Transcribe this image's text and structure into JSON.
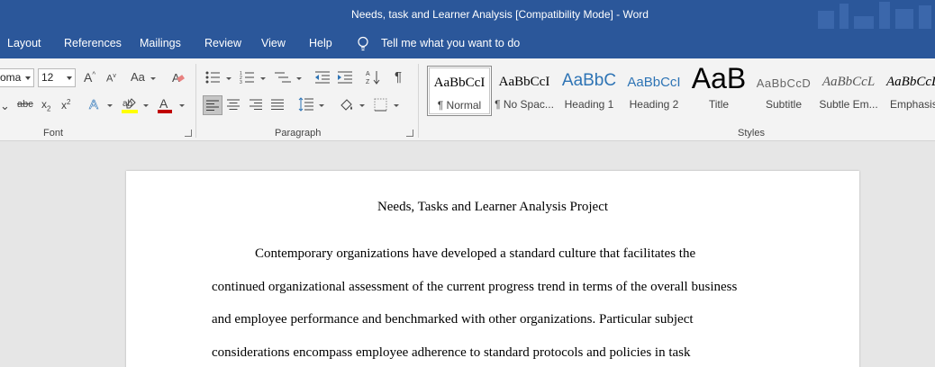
{
  "window": {
    "title": "Needs, task and Learner Analysis [Compatibility Mode]  -  Word"
  },
  "menu": {
    "tabs": [
      "Layout",
      "References",
      "Mailings",
      "Review",
      "View",
      "Help"
    ],
    "tell_me": "Tell me what you want to do"
  },
  "ribbon": {
    "font": {
      "group_label": "Font",
      "font_name": "oma",
      "font_size": "12",
      "font_color": "#c00000",
      "highlight_color": "#ffff00"
    },
    "paragraph": {
      "group_label": "Paragraph"
    },
    "styles": {
      "group_label": "Styles",
      "items": [
        {
          "preview": "AaBbCcI",
          "label": "¶ Normal"
        },
        {
          "preview": "AaBbCcI",
          "label": "¶ No Spac..."
        },
        {
          "preview": "AaBbC",
          "label": "Heading 1"
        },
        {
          "preview": "AaBbCcI",
          "label": "Heading 2"
        },
        {
          "preview": "AaB",
          "label": "Title"
        },
        {
          "preview": "AaBbCcD",
          "label": "Subtitle"
        },
        {
          "preview": "AaBbCcL",
          "label": "Subtle Em..."
        },
        {
          "preview": "AaBbCcL",
          "label": "Emphasis"
        }
      ]
    }
  },
  "document": {
    "title": "Needs, Tasks and Learner Analysis Project",
    "lines": [
      "Contemporary organizations have developed a standard culture that facilitates the",
      "continued organizational assessment of the current progress trend in terms of the overall business",
      "and employee performance and benchmarked with other organizations. Particular subject",
      "considerations encompass employee adherence to standard protocols and policies in task"
    ]
  },
  "colors": {
    "ribbon_blue": "#2b579a",
    "heading_blue": "#2e74b5"
  }
}
